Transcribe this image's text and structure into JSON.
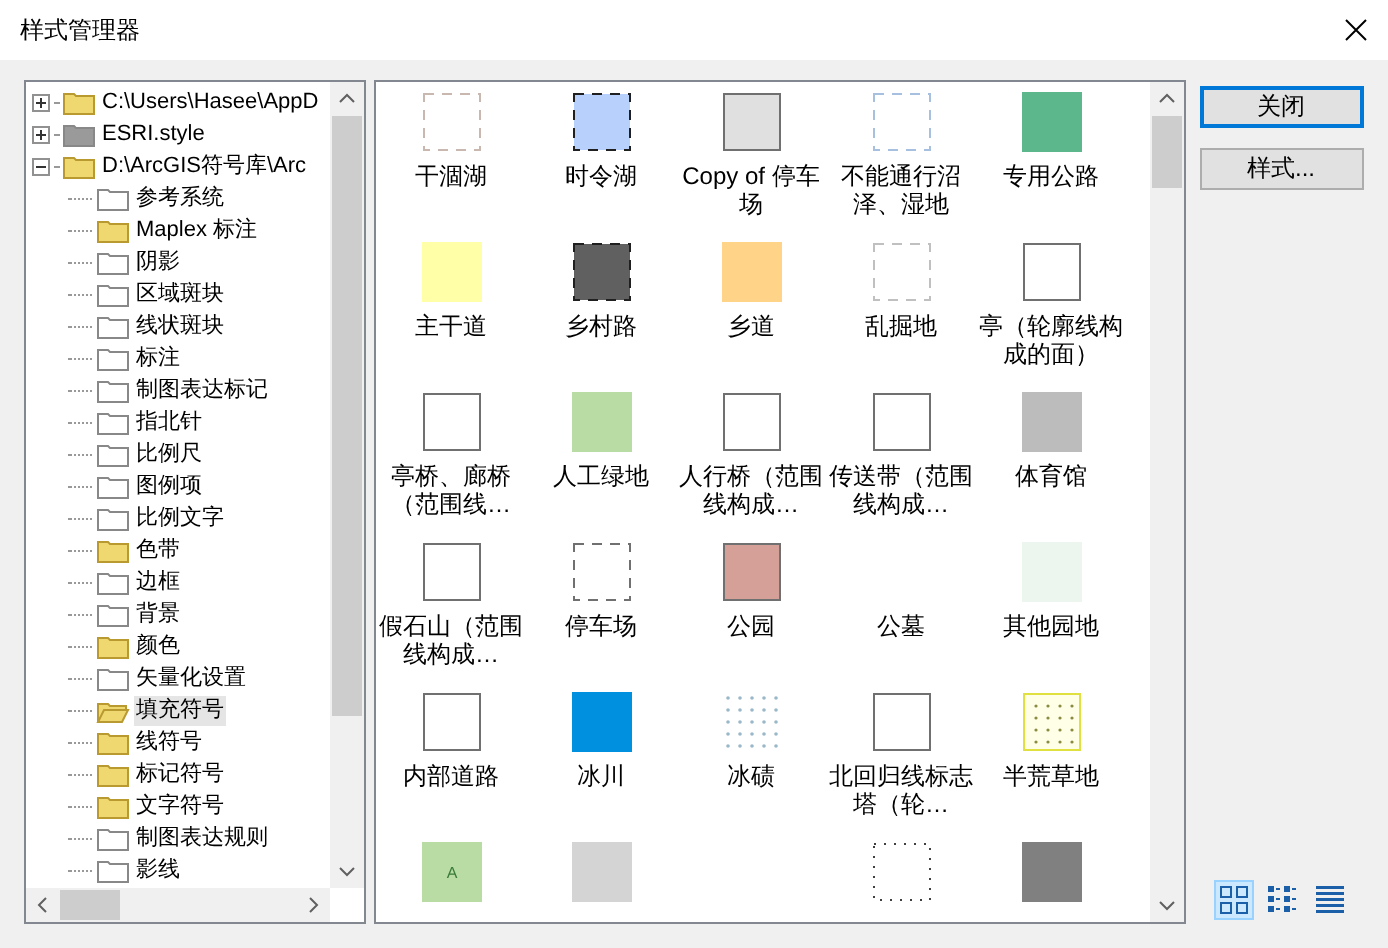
{
  "window": {
    "title": "样式管理器"
  },
  "tree": {
    "nodes": [
      {
        "label": "C:\\Users\\Hasee\\AppD",
        "kind": "filled",
        "expanded": false,
        "selected": false
      },
      {
        "label": "ESRI.style",
        "kind": "grey",
        "expanded": false,
        "selected": false
      },
      {
        "label": "D:\\ArcGIS符号库\\Arc",
        "kind": "filled",
        "expanded": true,
        "selected": false,
        "children": [
          {
            "label": "参考系统",
            "kind": "empty",
            "selected": false
          },
          {
            "label": "Maplex 标注",
            "kind": "filled",
            "selected": false
          },
          {
            "label": "阴影",
            "kind": "empty",
            "selected": false
          },
          {
            "label": "区域斑块",
            "kind": "empty",
            "selected": false
          },
          {
            "label": "线状斑块",
            "kind": "empty",
            "selected": false
          },
          {
            "label": "标注",
            "kind": "empty",
            "selected": false
          },
          {
            "label": "制图表达标记",
            "kind": "empty",
            "selected": false
          },
          {
            "label": "指北针",
            "kind": "empty",
            "selected": false
          },
          {
            "label": "比例尺",
            "kind": "empty",
            "selected": false
          },
          {
            "label": "图例项",
            "kind": "empty",
            "selected": false
          },
          {
            "label": "比例文字",
            "kind": "empty",
            "selected": false
          },
          {
            "label": "色带",
            "kind": "filled",
            "selected": false
          },
          {
            "label": "边框",
            "kind": "empty",
            "selected": false
          },
          {
            "label": "背景",
            "kind": "empty",
            "selected": false
          },
          {
            "label": "颜色",
            "kind": "filled",
            "selected": false
          },
          {
            "label": "矢量化设置",
            "kind": "empty",
            "selected": false
          },
          {
            "label": "填充符号",
            "kind": "filled",
            "selected": true
          },
          {
            "label": "线符号",
            "kind": "filled",
            "selected": false
          },
          {
            "label": "标记符号",
            "kind": "filled",
            "selected": false
          },
          {
            "label": "文字符号",
            "kind": "filled",
            "selected": false
          },
          {
            "label": "制图表达规则",
            "kind": "empty",
            "selected": false
          },
          {
            "label": "影线",
            "kind": "empty",
            "selected": false
          }
        ]
      }
    ]
  },
  "symbols": [
    {
      "label": "干涸湖",
      "kind": "dashed",
      "color": "#c8b8b0"
    },
    {
      "label": "时令湖",
      "kind": "dashed-fill",
      "color": "#b8d0fc"
    },
    {
      "label": "Copy of  停车场",
      "kind": "framed",
      "color": "#e0e0e0"
    },
    {
      "label": "不能通行沼泽、湿地",
      "kind": "dashed",
      "color": "#a8c0e0"
    },
    {
      "label": "专用公路",
      "kind": "fill",
      "color": "#5cb88c"
    },
    {
      "label": "主干道",
      "kind": "fill",
      "color": "#ffffa8"
    },
    {
      "label": "乡村路",
      "kind": "dashed-fill",
      "color": "#606060"
    },
    {
      "label": "乡道",
      "kind": "fill",
      "color": "#ffd488"
    },
    {
      "label": "乱掘地",
      "kind": "dashed",
      "color": "#c0c0c0"
    },
    {
      "label": "亭（轮廓线构成的面）",
      "kind": "framed"
    },
    {
      "label": "亭桥、廊桥（范围线…",
      "kind": "framed"
    },
    {
      "label": "人工绿地",
      "kind": "fill",
      "color": "#b8dca4"
    },
    {
      "label": "人行桥（范围线构成…",
      "kind": "framed"
    },
    {
      "label": "传送带（范围线构成…",
      "kind": "framed"
    },
    {
      "label": "体育馆",
      "kind": "fill",
      "color": "#bcbcbc"
    },
    {
      "label": "假石山（范围线构成…",
      "kind": "framed"
    },
    {
      "label": "停车场",
      "kind": "dashed",
      "color": "#707070"
    },
    {
      "label": "公园",
      "kind": "framed",
      "color": "#d4a098"
    },
    {
      "label": "公墓",
      "kind": "blank"
    },
    {
      "label": "其他园地",
      "kind": "fill",
      "color": "#ecf6ee"
    },
    {
      "label": "内部道路",
      "kind": "framed"
    },
    {
      "label": "冰川",
      "kind": "fill",
      "color": "#0090e0"
    },
    {
      "label": "冰碛",
      "kind": "dots",
      "color": "#9ab8c8"
    },
    {
      "label": "北回归线标志塔（轮…",
      "kind": "framed"
    },
    {
      "label": "半荒草地",
      "kind": "dots-framed",
      "color": "#e0e040"
    },
    {
      "kind": "lettered",
      "color": "#b8dca4",
      "mark": "A"
    },
    {
      "kind": "fill",
      "color": "#d4d4d4"
    },
    {
      "kind": "blank"
    },
    {
      "kind": "dotted",
      "color": "#404040"
    },
    {
      "kind": "fill",
      "color": "#808080"
    }
  ],
  "buttons": [
    {
      "label": "关闭",
      "default": true
    },
    {
      "label": "样式...",
      "default": false
    }
  ],
  "view_modes": [
    {
      "kind": "large",
      "selected": true
    },
    {
      "kind": "small",
      "selected": false
    },
    {
      "kind": "list",
      "selected": false
    }
  ]
}
